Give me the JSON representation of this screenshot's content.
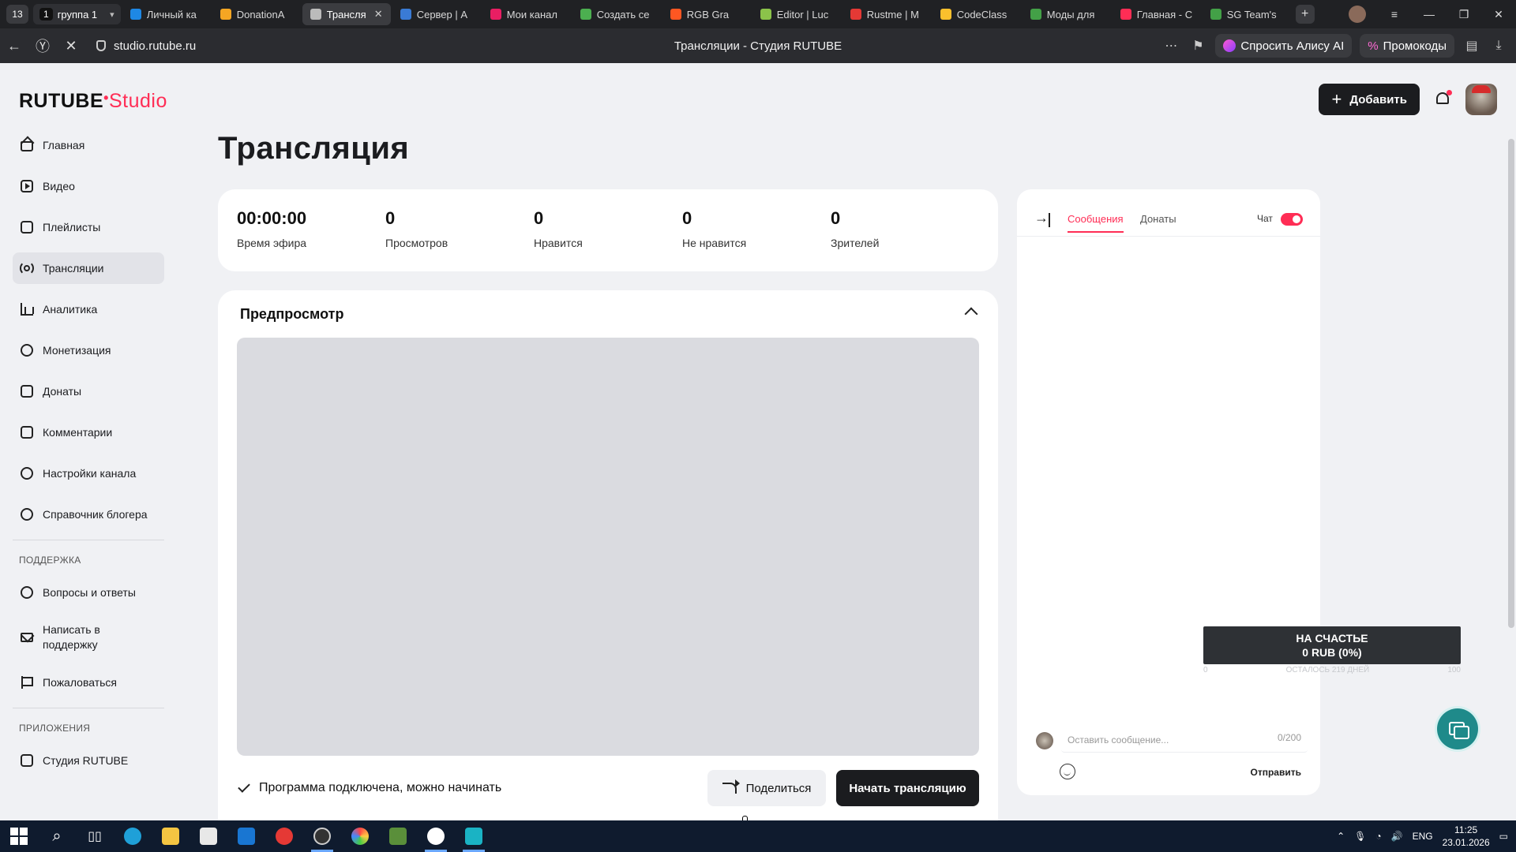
{
  "browser": {
    "tab_counter": "13",
    "group": {
      "number": "1",
      "label": "группа 1"
    },
    "tabs": [
      {
        "title": "Личный ка",
        "color": "#1e88e5"
      },
      {
        "title": "DonationA",
        "color": "#f5a623"
      },
      {
        "title": "Трансля",
        "color": "#bbbbbb",
        "active": true
      },
      {
        "title": "Сервер | А",
        "color": "#3a7bd5"
      },
      {
        "title": "Мои канал",
        "color": "#e91e63"
      },
      {
        "title": "Создать се",
        "color": "#4caf50"
      },
      {
        "title": "RGB Gra",
        "color": "#ff5722"
      },
      {
        "title": "Editor | Luc",
        "color": "#8bc34a"
      },
      {
        "title": "Rustme | M",
        "color": "#e53935"
      },
      {
        "title": "CodeClass",
        "color": "#fbc02d"
      },
      {
        "title": "Моды для",
        "color": "#43a047"
      },
      {
        "title": "Главная - С",
        "color": "#ff2d55"
      },
      {
        "title": "SG Team's",
        "color": "#43a047"
      }
    ],
    "url": "studio.rutube.ru",
    "page_title": "Трансляции - Студия RUTUBE",
    "alice_label": "Спросить Алису AI",
    "promo_label": "Промокоды"
  },
  "header": {
    "logo_main": "RUTUBE",
    "logo_sub": "Studio",
    "add_label": "Добавить"
  },
  "sidebar": {
    "items": [
      {
        "label": "Главная",
        "icon": "home-icon"
      },
      {
        "label": "Видео",
        "icon": "video-icon"
      },
      {
        "label": "Плейлисты",
        "icon": "playlist-icon"
      },
      {
        "label": "Трансляции",
        "icon": "broadcast-icon",
        "active": true
      },
      {
        "label": "Аналитика",
        "icon": "analytics-icon"
      },
      {
        "label": "Монетизация",
        "icon": "ruble-icon"
      },
      {
        "label": "Донаты",
        "icon": "wallet-icon"
      },
      {
        "label": "Комментарии",
        "icon": "comments-icon"
      },
      {
        "label": "Настройки канала",
        "icon": "gear-icon"
      },
      {
        "label": "Справочник блогера",
        "icon": "info-icon"
      }
    ],
    "support_heading": "Поддержка",
    "support_items": [
      {
        "label": "Вопросы и ответы",
        "icon": "question-icon"
      },
      {
        "label": "Написать в поддержку",
        "icon": "mail-icon"
      },
      {
        "label": "Пожаловаться",
        "icon": "flag-icon"
      }
    ],
    "apps_heading": "Приложения",
    "apps_items": [
      {
        "label": "Студия RUTUBE",
        "icon": "studio-app-icon"
      }
    ]
  },
  "main": {
    "title": "Трансляция",
    "stats": [
      {
        "value": "00:00:00",
        "label": "Время эфира"
      },
      {
        "value": "0",
        "label": "Просмотров"
      },
      {
        "value": "0",
        "label": "Нравится"
      },
      {
        "value": "0",
        "label": "Не нравится"
      },
      {
        "value": "0",
        "label": "Зрителей"
      }
    ],
    "preview_title": "Предпросмотр",
    "status_text": "Программа подключена, можно начинать",
    "share_label": "Поделиться",
    "start_label": "Начать трансляцию"
  },
  "chat": {
    "tabs": [
      "Сообщения",
      "Донаты"
    ],
    "toggle_label": "Чат",
    "input_placeholder": "Оставить сообщение...",
    "counter": "0/200",
    "send_label": "Отправить"
  },
  "donation_overlay": {
    "line1": "НА СЧАСТЬЕ",
    "line2": "0 RUB (0%)",
    "start": "0",
    "remaining": "ОСТАЛОСЬ 219 ДНЕЙ",
    "goal": "100"
  },
  "taskbar": {
    "lang": "ENG",
    "time": "11:25",
    "date": "23.01.2026"
  },
  "colors": {
    "accent": "#ff2d55",
    "dark_button": "#1b1c1f",
    "page_bg": "#f0f1f4"
  }
}
